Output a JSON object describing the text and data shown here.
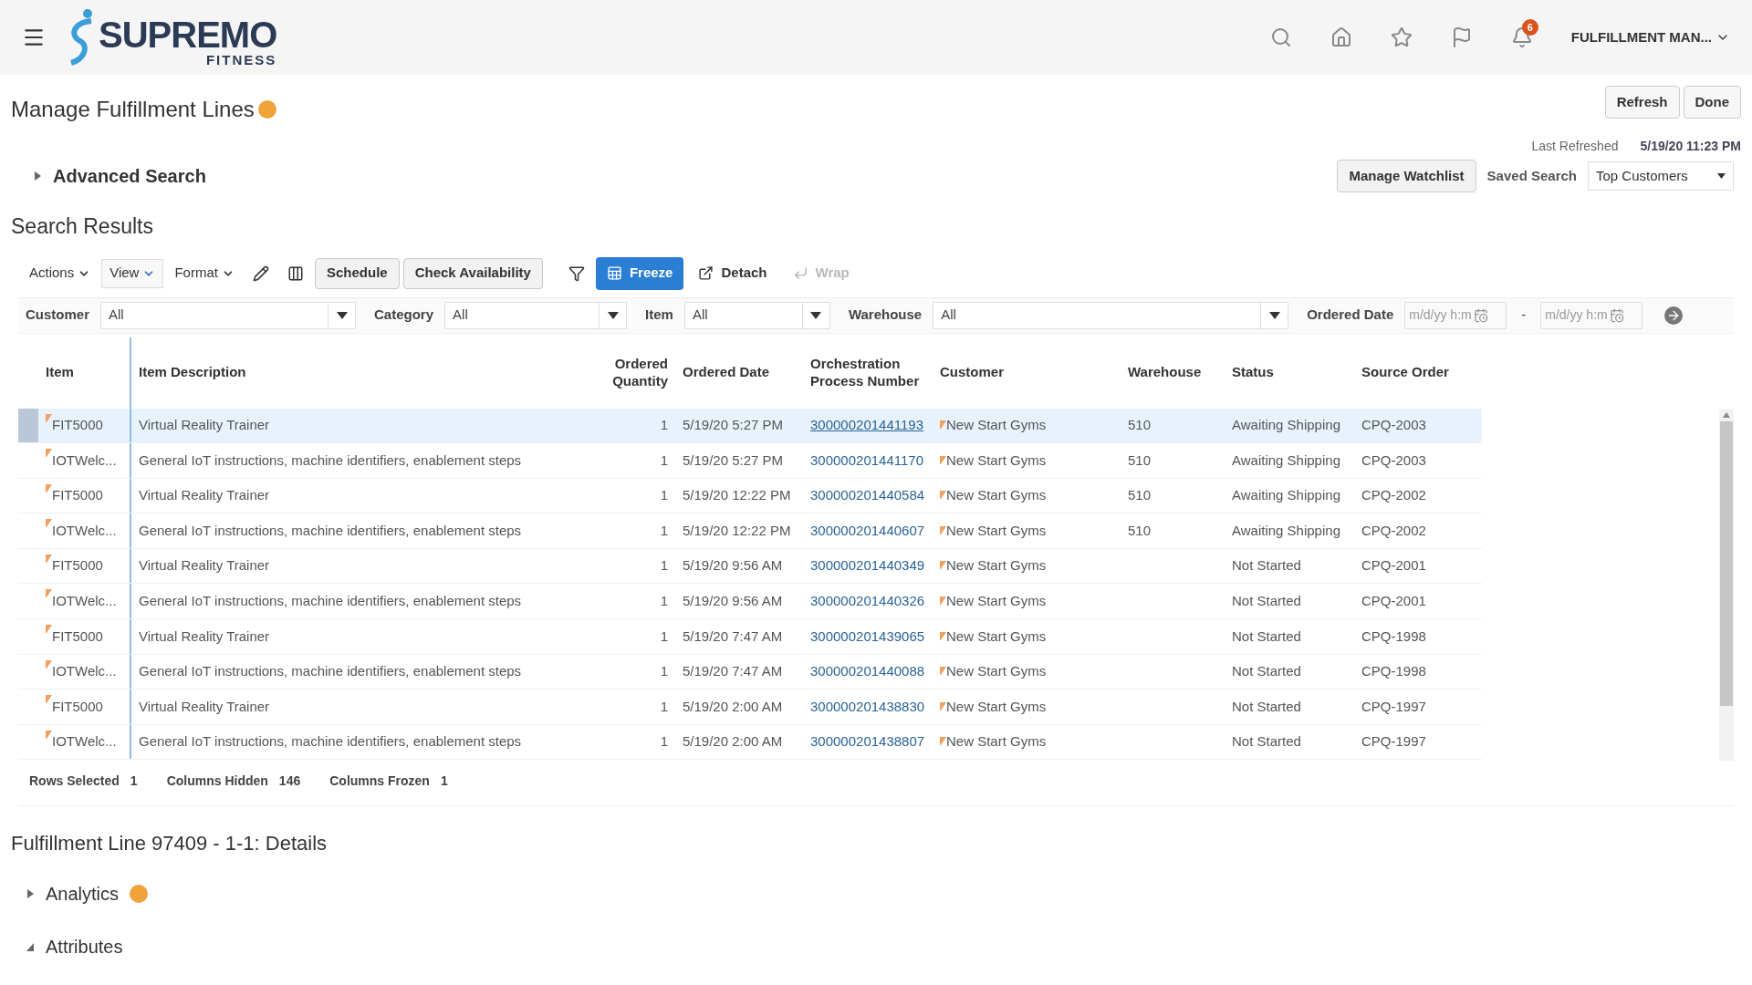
{
  "header": {
    "logo_main": "SUPREMO",
    "logo_sub": "FITNESS",
    "notification_count": "6",
    "user_menu": "FULFILLMENT MAN..."
  },
  "page": {
    "title": "Manage Fulfillment Lines",
    "buttons": [
      "Refresh",
      "Done"
    ],
    "last_refreshed_label": "Last Refreshed",
    "last_refreshed_value": "5/19/20 11:23 PM"
  },
  "advanced_search": {
    "label": "Advanced Search",
    "expanded": false
  },
  "saved_search": {
    "watchlist_button": "Manage Watchlist",
    "label": "Saved Search",
    "value": "Top Customers"
  },
  "search_results": {
    "title": "Search Results",
    "toolbar": [
      {
        "kind": "menu",
        "label": "Actions",
        "selected": false,
        "disabled": false
      },
      {
        "kind": "boxmenu",
        "label": "View",
        "selected": false,
        "disabled": false
      },
      {
        "kind": "menu",
        "label": "Format",
        "selected": false,
        "disabled": false
      },
      {
        "kind": "pencil",
        "selected": false,
        "disabled": false
      },
      {
        "kind": "columns",
        "selected": false,
        "disabled": false
      },
      {
        "kind": "button",
        "label": "Schedule",
        "selected": false,
        "disabled": false
      },
      {
        "kind": "button",
        "label": "Check Availability",
        "selected": false,
        "disabled": false
      },
      {
        "kind": "filter",
        "selected": false,
        "disabled": false
      },
      {
        "kind": "freeze",
        "label": "Freeze",
        "selected": true,
        "disabled": false
      },
      {
        "kind": "detach",
        "label": "Detach",
        "selected": false,
        "disabled": false
      },
      {
        "kind": "wrap",
        "label": "Wrap",
        "selected": false,
        "disabled": true
      }
    ],
    "filters": [
      {
        "kind": "select",
        "label": "Customer",
        "value": "All"
      },
      {
        "kind": "select",
        "label": "Category",
        "value": "All"
      },
      {
        "kind": "select",
        "label": "Item",
        "value": "All"
      },
      {
        "kind": "select",
        "label": "Warehouse",
        "value": "All"
      },
      {
        "kind": "daterange",
        "label": "Ordered Date",
        "placeholder": "m/d/yy h:m",
        "placeholder_end": "m/d/yy h:m",
        "separator": "-"
      }
    ],
    "columns": [
      "Item",
      "Item Description",
      "Ordered Quantity",
      "Ordered Date",
      "Orchestration Process Number",
      "Customer",
      "Warehouse",
      "Status",
      "Source Order"
    ],
    "rows": [
      {
        "selected": true,
        "item": "FIT5000",
        "description": "Virtual Reality Trainer",
        "quantity": "1",
        "date": "5/19/20 5:27 PM",
        "process_number": "300000201441193",
        "customer": "New Start Gyms",
        "warehouse": "510",
        "status": "Awaiting Shipping",
        "source_order": "CPQ-2003"
      },
      {
        "selected": false,
        "item": "IOTWelc...",
        "description": "General IoT instructions, machine identifiers, enablement steps",
        "quantity": "1",
        "date": "5/19/20 5:27 PM",
        "process_number": "300000201441170",
        "customer": "New Start Gyms",
        "warehouse": "510",
        "status": "Awaiting Shipping",
        "source_order": "CPQ-2003"
      },
      {
        "selected": false,
        "item": "FIT5000",
        "description": "Virtual Reality Trainer",
        "quantity": "1",
        "date": "5/19/20 12:22 PM",
        "process_number": "300000201440584",
        "customer": "New Start Gyms",
        "warehouse": "510",
        "status": "Awaiting Shipping",
        "source_order": "CPQ-2002"
      },
      {
        "selected": false,
        "item": "IOTWelc...",
        "description": "General IoT instructions, machine identifiers, enablement steps",
        "quantity": "1",
        "date": "5/19/20 12:22 PM",
        "process_number": "300000201440607",
        "customer": "New Start Gyms",
        "warehouse": "510",
        "status": "Awaiting Shipping",
        "source_order": "CPQ-2002"
      },
      {
        "selected": false,
        "item": "FIT5000",
        "description": "Virtual Reality Trainer",
        "quantity": "1",
        "date": "5/19/20 9:56 AM",
        "process_number": "300000201440349",
        "customer": "New Start Gyms",
        "status": "Not Started",
        "source_order": "CPQ-2001"
      },
      {
        "selected": false,
        "item": "IOTWelc...",
        "description": "General IoT instructions, machine identifiers, enablement steps",
        "quantity": "1",
        "date": "5/19/20 9:56 AM",
        "process_number": "300000201440326",
        "customer": "New Start Gyms",
        "status": "Not Started",
        "source_order": "CPQ-2001"
      },
      {
        "selected": false,
        "item": "FIT5000",
        "description": "Virtual Reality Trainer",
        "quantity": "1",
        "date": "5/19/20 7:47 AM",
        "process_number": "300000201439065",
        "customer": "New Start Gyms",
        "status": "Not Started",
        "source_order": "CPQ-1998"
      },
      {
        "selected": false,
        "item": "IOTWelc...",
        "description": "General IoT instructions, machine identifiers, enablement steps",
        "quantity": "1",
        "date": "5/19/20 7:47 AM",
        "process_number": "300000201440088",
        "customer": "New Start Gyms",
        "status": "Not Started",
        "source_order": "CPQ-1998"
      },
      {
        "selected": false,
        "item": "FIT5000",
        "description": "Virtual Reality Trainer",
        "quantity": "1",
        "date": "5/19/20 2:00 AM",
        "process_number": "300000201438830",
        "customer": "New Start Gyms",
        "status": "Not Started",
        "source_order": "CPQ-1997"
      },
      {
        "selected": false,
        "item": "IOTWelc...",
        "description": "General IoT instructions, machine identifiers, enablement steps",
        "quantity": "1",
        "date": "5/19/20 2:00 AM",
        "process_number": "300000201438807",
        "customer": "New Start Gyms",
        "status": "Not Started",
        "source_order": "CPQ-1997"
      }
    ],
    "footer": [
      {
        "label": "Rows Selected",
        "value": "1"
      },
      {
        "label": "Columns Hidden",
        "value": "146"
      },
      {
        "label": "Columns Frozen",
        "value": "1"
      }
    ]
  },
  "details": {
    "title": "Fulfillment Line 97409 - 1-1: Details",
    "sections": [
      {
        "label": "Analytics",
        "expanded": false,
        "help": true
      },
      {
        "label": "Attributes",
        "expanded": true,
        "help": false
      }
    ]
  }
}
